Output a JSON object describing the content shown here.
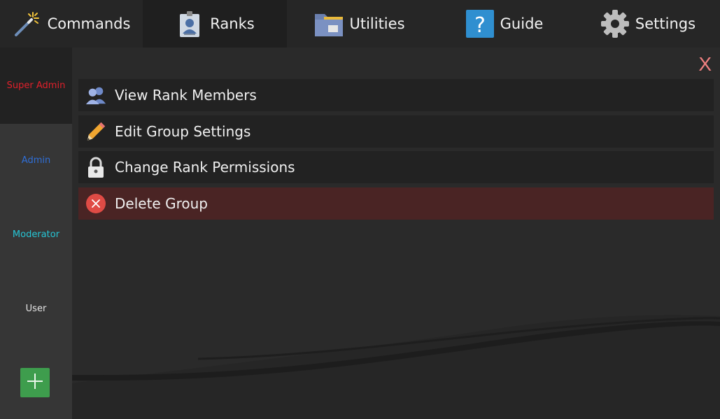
{
  "tabs": [
    {
      "label": "Commands",
      "icon": "magic-wand-icon"
    },
    {
      "label": "Ranks",
      "icon": "id-badge-icon"
    },
    {
      "label": "Utilities",
      "icon": "folder-icon"
    },
    {
      "label": "Guide",
      "icon": "help-icon"
    },
    {
      "label": "Settings",
      "icon": "gear-icon"
    }
  ],
  "sidebar": {
    "ranks": [
      {
        "label": "Super Admin",
        "color": "#e0202b"
      },
      {
        "label": "Admin",
        "color": "#2f6fd8"
      },
      {
        "label": "Moderator",
        "color": "#26c6d6"
      },
      {
        "label": "User",
        "color": "#e6e6e6"
      }
    ],
    "add_icon": "plus-icon"
  },
  "panel": {
    "close_label": "X",
    "items": [
      {
        "label": "View Rank Members",
        "icon": "users-icon"
      },
      {
        "label": "Edit Group Settings",
        "icon": "pencil-icon"
      },
      {
        "label": "Change Rank Permissions",
        "icon": "padlock-icon"
      },
      {
        "label": "Delete Group",
        "icon": "delete-icon"
      }
    ]
  },
  "colors": {
    "accent_add": "#3e9d4d",
    "danger_row": "#4a2424",
    "close": "#f08080"
  }
}
